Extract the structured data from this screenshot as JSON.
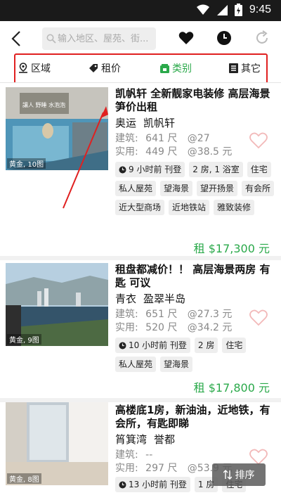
{
  "status_bar": {
    "time": "9:45"
  },
  "search": {
    "placeholder": "输入地区、屋苑、街..."
  },
  "filters": [
    {
      "label": "区域",
      "icon": "location-pin-icon"
    },
    {
      "label": "租价",
      "icon": "price-tag-icon"
    },
    {
      "label": "类别",
      "icon": "category-icon"
    },
    {
      "label": "其它",
      "icon": "document-icon"
    }
  ],
  "listings": [
    {
      "photo_caption": "黄金, 10图",
      "photo_sign": "讓人 野睡 水泡泡",
      "title": "凯帆轩 全新靓家电装修 高层海景 笋价出租",
      "district": "奥运",
      "estate": "凯帆轩",
      "gross_label": "建筑:",
      "gross_area": "641 尺",
      "gross_price": "@27",
      "net_label": "实用:",
      "net_area": "449 尺",
      "net_price": "@38.5 元",
      "tags": [
        "9 小时前 刊登",
        "2 房, 1 浴室",
        "住宅",
        "私人屋苑",
        "望海景",
        "望开扬景",
        "有会所",
        "近大型商场",
        "近地铁站",
        "雅致装修"
      ],
      "price": "租 $17,300 元"
    },
    {
      "photo_caption": "黄金, 9图",
      "title": "租盘都减价！！ 高层海景两房 有匙 可议",
      "district": "青衣",
      "estate": "盈翠半岛",
      "gross_label": "建筑:",
      "gross_area": "651 尺",
      "gross_price": "@27.3 元",
      "net_label": "实用:",
      "net_area": "520 尺",
      "net_price": "@34.2 元",
      "tags": [
        "10 小时前 刊登",
        "2 房",
        "住宅",
        "私人屋苑",
        "望海景"
      ],
      "price": "租 $17,800 元"
    },
    {
      "photo_caption": "黄金, 8图",
      "title": "高楼底1房，新油油，近地铁，有会所，有匙即睇",
      "district": "筲箕湾",
      "estate": "誉都",
      "gross_label": "建筑:",
      "gross_area": "--",
      "gross_price": "",
      "net_label": "实用:",
      "net_area": "297 尺",
      "net_price": "@53.9 元",
      "tags": [
        "13 小时前 刊登",
        "1 房",
        "住宅"
      ],
      "price": ""
    }
  ],
  "sort_button": {
    "label": "排序"
  },
  "colors": {
    "accent_green": "#2aa94a",
    "annotation_red": "#e02020",
    "status_bar": "#1a1a1a"
  }
}
